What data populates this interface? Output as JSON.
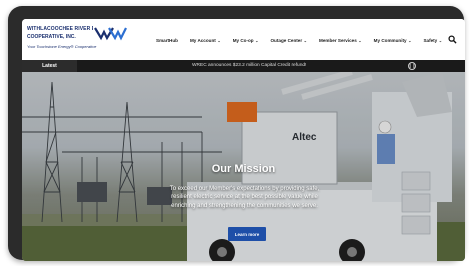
{
  "logo": {
    "line1": "WITHLACOOCHEE RIVER ELECTRIC",
    "line2": "COOPERATIVE, INC.",
    "line3": "Your Touchstone Energy® Cooperative"
  },
  "nav": {
    "items": [
      {
        "label": "SmartHub",
        "has_dropdown": false
      },
      {
        "label": "My Account",
        "has_dropdown": true
      },
      {
        "label": "My Co-op",
        "has_dropdown": true
      },
      {
        "label": "Outage Center",
        "has_dropdown": true
      },
      {
        "label": "Member Services",
        "has_dropdown": true
      },
      {
        "label": "My Community",
        "has_dropdown": true
      },
      {
        "label": "Safety",
        "has_dropdown": true
      }
    ],
    "search_icon": "search-icon"
  },
  "ticker": {
    "label": "Latest",
    "message": "WREC announces $23.2 million Capital Credit refund!",
    "control_icon": "pause-icon"
  },
  "hero": {
    "title": "Our Mission",
    "body": "To exceed our Member's expectations by providing safe, resilient electric service at the best possible value while enriching and strengthening the communities we serve.",
    "button": "Learn more",
    "truck_brand": "Altec"
  },
  "colors": {
    "brand_blue": "#1a2f6e",
    "button_blue": "#1e4fa8",
    "ticker_bg": "#1a1a1a"
  }
}
